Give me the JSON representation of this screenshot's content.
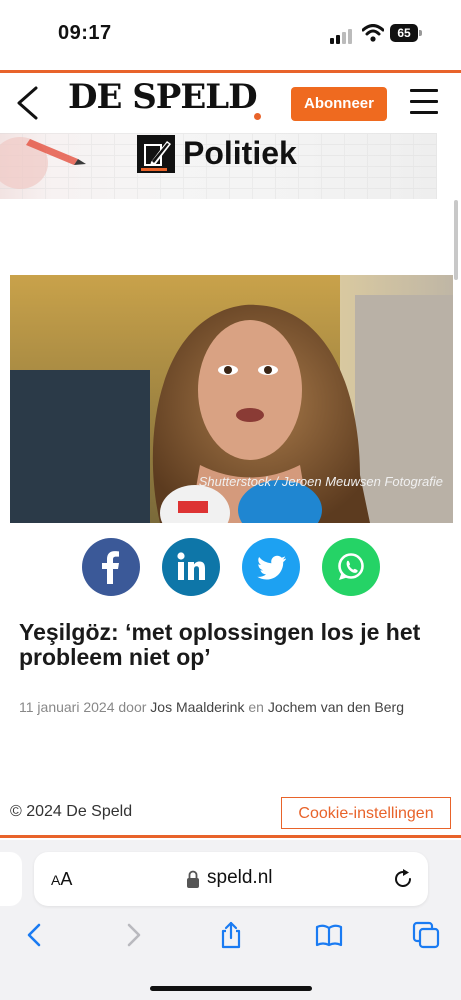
{
  "status": {
    "time": "09:17",
    "battery": "65"
  },
  "header": {
    "logo": "DE SPELD",
    "subscribe_label": "Abonneer"
  },
  "category": {
    "label": "Politiek"
  },
  "hero": {
    "credit": "Shutterstock / Jeroen Meuwsen Fotografie"
  },
  "share": {
    "buttons": [
      {
        "name": "facebook",
        "color": "#3b5998"
      },
      {
        "name": "linkedin",
        "color": "#0e76a8"
      },
      {
        "name": "twitter",
        "color": "#1da1f2"
      },
      {
        "name": "whatsapp",
        "color": "#25d366"
      }
    ]
  },
  "article": {
    "title": "Yeşilgöz: ‘met oplossingen los je het probleem niet op’",
    "date": "11 januari 2024",
    "by_word": "door",
    "author1": "Jos Maalderink",
    "and_word": "en",
    "author2": "Jochem van den Berg"
  },
  "footer": {
    "copyright": "© 2024 De Speld",
    "cookie_label": "Cookie-instellingen"
  },
  "browser": {
    "aa_small": "A",
    "aa_large": "A",
    "url": "speld.nl"
  },
  "colors": {
    "accent": "#e8632a",
    "subscribe": "#ef6a1f"
  }
}
